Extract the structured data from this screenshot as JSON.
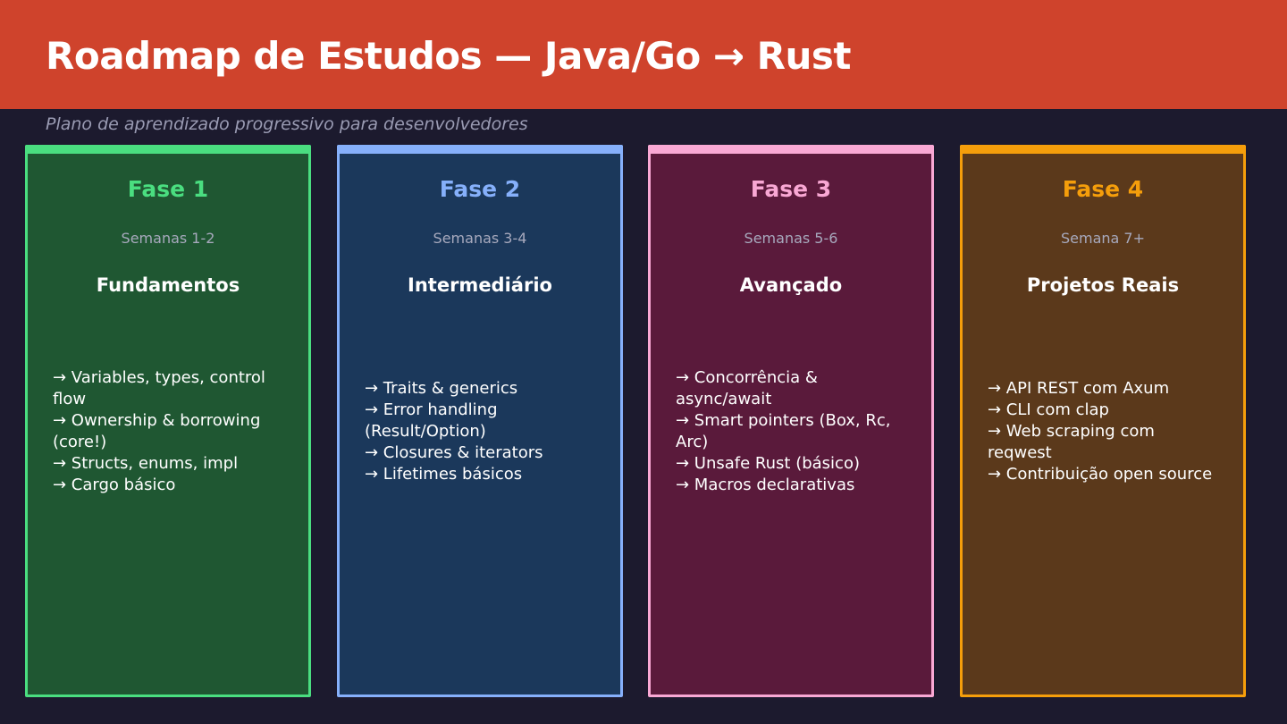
{
  "header": {
    "title": "Roadmap de Estudos — Java/Go → Rust",
    "subtitle": "Plano de aprendizado progressivo para desenvolvedores",
    "background": "#cf432c"
  },
  "phases": [
    {
      "phase": "Fase 1",
      "weeks": "Semanas 1-2",
      "heading": "Fundamentos",
      "accent": "#4ade80",
      "fill": "#1f5732",
      "items": [
        "→ Variables, types, control flow",
        "→ Ownership & borrowing (core!)",
        "→ Structs, enums, impl",
        "→ Cargo básico"
      ]
    },
    {
      "phase": "Fase 2",
      "weeks": "Semanas 3-4",
      "heading": "Intermediário",
      "accent": "#86b0fb",
      "fill": "#1b385b",
      "items": [
        "→ Traits & generics",
        "→ Error handling (Result/Option)",
        "→ Closures & iterators",
        "→ Lifetimes básicos"
      ]
    },
    {
      "phase": "Fase 3",
      "weeks": "Semanas 5-6",
      "heading": "Avançado",
      "accent": "#f9a8d4",
      "fill": "#5a1a3b",
      "items": [
        "→ Concorrência & async/await",
        "→ Smart pointers (Box, Rc, Arc)",
        "→ Unsafe Rust (básico)",
        "→ Macros declarativas"
      ]
    },
    {
      "phase": "Fase 4",
      "weeks": "Semana 7+",
      "heading": "Projetos Reais",
      "accent": "#f59e0b",
      "fill": "#5b391b",
      "items": [
        "→ API REST com Axum",
        "→ CLI com clap",
        "→ Web scraping com reqwest",
        "→ Contribuição open source"
      ]
    }
  ]
}
